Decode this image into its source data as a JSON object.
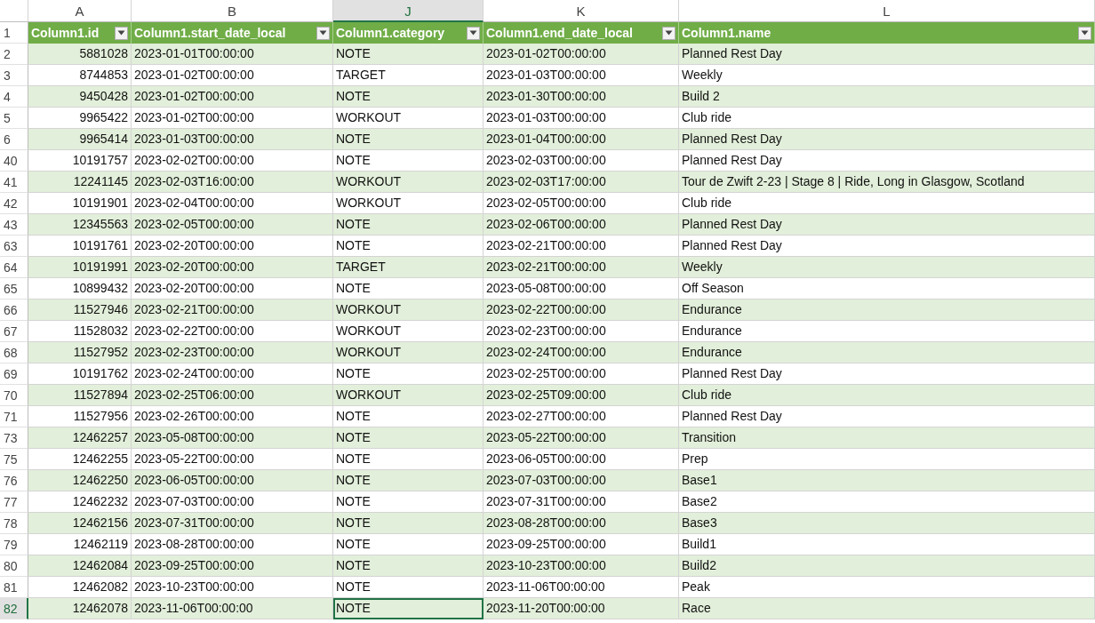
{
  "columns": [
    {
      "letter": "A",
      "selected": false
    },
    {
      "letter": "B",
      "selected": false
    },
    {
      "letter": "J",
      "selected": true
    },
    {
      "letter": "K",
      "selected": false
    },
    {
      "letter": "L",
      "selected": false
    }
  ],
  "header_row": {
    "number": "1",
    "headers": [
      "Column1.id",
      "Column1.start_date_local",
      "Column1.category",
      "Column1.end_date_local",
      "Column1.name"
    ]
  },
  "rows": [
    {
      "number": "2",
      "selected": false,
      "cells": [
        "5881028",
        "2023-01-01T00:00:00",
        "NOTE",
        "2023-01-02T00:00:00",
        "Planned Rest Day"
      ]
    },
    {
      "number": "3",
      "selected": false,
      "cells": [
        "8744853",
        "2023-01-02T00:00:00",
        "TARGET",
        "2023-01-03T00:00:00",
        "Weekly"
      ]
    },
    {
      "number": "4",
      "selected": false,
      "cells": [
        "9450428",
        "2023-01-02T00:00:00",
        "NOTE",
        "2023-01-30T00:00:00",
        "Build 2"
      ]
    },
    {
      "number": "5",
      "selected": false,
      "cells": [
        "9965422",
        "2023-01-02T00:00:00",
        "WORKOUT",
        "2023-01-03T00:00:00",
        "Club ride"
      ]
    },
    {
      "number": "6",
      "selected": false,
      "cells": [
        "9965414",
        "2023-01-03T00:00:00",
        "NOTE",
        "2023-01-04T00:00:00",
        "Planned Rest Day"
      ]
    },
    {
      "number": "40",
      "selected": false,
      "cells": [
        "10191757",
        "2023-02-02T00:00:00",
        "NOTE",
        "2023-02-03T00:00:00",
        "Planned Rest Day"
      ]
    },
    {
      "number": "41",
      "selected": false,
      "cells": [
        "12241145",
        "2023-02-03T16:00:00",
        "WORKOUT",
        "2023-02-03T17:00:00",
        "Tour de Zwift 2-23 | Stage 8 | Ride, Long in Glasgow, Scotland"
      ]
    },
    {
      "number": "42",
      "selected": false,
      "cells": [
        "10191901",
        "2023-02-04T00:00:00",
        "WORKOUT",
        "2023-02-05T00:00:00",
        "Club ride"
      ]
    },
    {
      "number": "43",
      "selected": false,
      "cells": [
        "12345563",
        "2023-02-05T00:00:00",
        "NOTE",
        "2023-02-06T00:00:00",
        "Planned Rest Day"
      ]
    },
    {
      "number": "63",
      "selected": false,
      "cells": [
        "10191761",
        "2023-02-20T00:00:00",
        "NOTE",
        "2023-02-21T00:00:00",
        "Planned Rest Day"
      ]
    },
    {
      "number": "64",
      "selected": false,
      "cells": [
        "10191991",
        "2023-02-20T00:00:00",
        "TARGET",
        "2023-02-21T00:00:00",
        "Weekly"
      ]
    },
    {
      "number": "65",
      "selected": false,
      "cells": [
        "10899432",
        "2023-02-20T00:00:00",
        "NOTE",
        "2023-05-08T00:00:00",
        "Off Season"
      ]
    },
    {
      "number": "66",
      "selected": false,
      "cells": [
        "11527946",
        "2023-02-21T00:00:00",
        "WORKOUT",
        "2023-02-22T00:00:00",
        "Endurance"
      ]
    },
    {
      "number": "67",
      "selected": false,
      "cells": [
        "11528032",
        "2023-02-22T00:00:00",
        "WORKOUT",
        "2023-02-23T00:00:00",
        "Endurance"
      ]
    },
    {
      "number": "68",
      "selected": false,
      "cells": [
        "11527952",
        "2023-02-23T00:00:00",
        "WORKOUT",
        "2023-02-24T00:00:00",
        "Endurance"
      ]
    },
    {
      "number": "69",
      "selected": false,
      "cells": [
        "10191762",
        "2023-02-24T00:00:00",
        "NOTE",
        "2023-02-25T00:00:00",
        "Planned Rest Day"
      ]
    },
    {
      "number": "70",
      "selected": false,
      "cells": [
        "11527894",
        "2023-02-25T06:00:00",
        "WORKOUT",
        "2023-02-25T09:00:00",
        "Club ride"
      ]
    },
    {
      "number": "71",
      "selected": false,
      "cells": [
        "11527956",
        "2023-02-26T00:00:00",
        "NOTE",
        "2023-02-27T00:00:00",
        "Planned Rest Day"
      ]
    },
    {
      "number": "73",
      "selected": false,
      "cells": [
        "12462257",
        "2023-05-08T00:00:00",
        "NOTE",
        "2023-05-22T00:00:00",
        "Transition"
      ]
    },
    {
      "number": "75",
      "selected": false,
      "cells": [
        "12462255",
        "2023-05-22T00:00:00",
        "NOTE",
        "2023-06-05T00:00:00",
        "Prep"
      ]
    },
    {
      "number": "76",
      "selected": false,
      "cells": [
        "12462250",
        "2023-06-05T00:00:00",
        "NOTE",
        "2023-07-03T00:00:00",
        "Base1"
      ]
    },
    {
      "number": "77",
      "selected": false,
      "cells": [
        "12462232",
        "2023-07-03T00:00:00",
        "NOTE",
        "2023-07-31T00:00:00",
        "Base2"
      ]
    },
    {
      "number": "78",
      "selected": false,
      "cells": [
        "12462156",
        "2023-07-31T00:00:00",
        "NOTE",
        "2023-08-28T00:00:00",
        "Base3"
      ]
    },
    {
      "number": "79",
      "selected": false,
      "cells": [
        "12462119",
        "2023-08-28T00:00:00",
        "NOTE",
        "2023-09-25T00:00:00",
        "Build1"
      ]
    },
    {
      "number": "80",
      "selected": false,
      "cells": [
        "12462084",
        "2023-09-25T00:00:00",
        "NOTE",
        "2023-10-23T00:00:00",
        "Build2"
      ]
    },
    {
      "number": "81",
      "selected": false,
      "cells": [
        "12462082",
        "2023-10-23T00:00:00",
        "NOTE",
        "2023-11-06T00:00:00",
        "Peak"
      ]
    },
    {
      "number": "82",
      "selected": true,
      "cells": [
        "12462078",
        "2023-11-06T00:00:00",
        "NOTE",
        "2023-11-20T00:00:00",
        "Race"
      ]
    }
  ]
}
